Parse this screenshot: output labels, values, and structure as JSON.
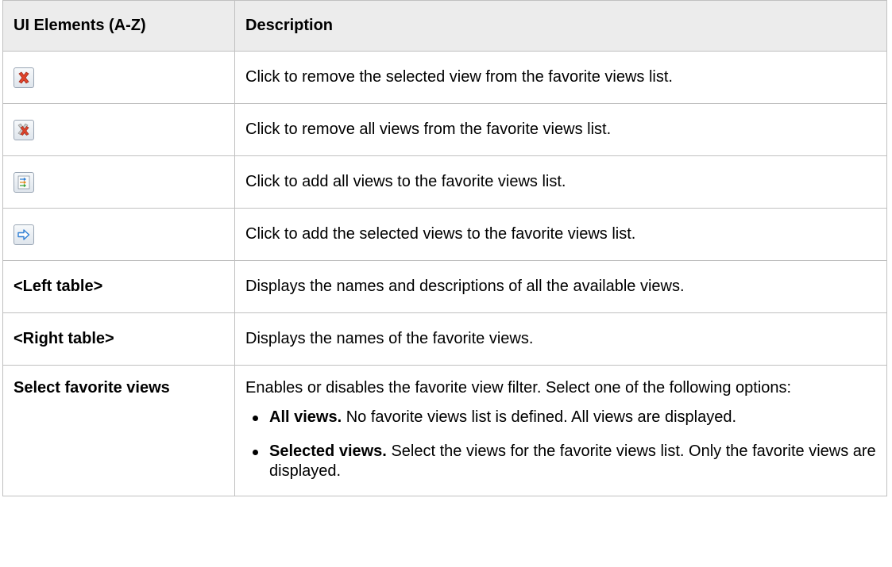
{
  "table": {
    "headers": {
      "col1": "UI Elements (A-Z)",
      "col2": "Description"
    },
    "rows": [
      {
        "icon": "remove-selected-icon",
        "description": "Click to remove the selected view from the favorite views list."
      },
      {
        "icon": "remove-all-icon",
        "description": "Click to remove all views from the favorite views list."
      },
      {
        "icon": "add-all-icon",
        "description": "Click to add all views to the favorite views list."
      },
      {
        "icon": "add-selected-icon",
        "description": "Click to add the selected views to the favorite views list."
      },
      {
        "element": "<Left table>",
        "description": "Displays the names and descriptions of all the available views."
      },
      {
        "element": "<Right table>",
        "description": "Displays the names of the favorite views."
      },
      {
        "element": "Select favorite views",
        "description": "Enables or disables the favorite view filter. Select one of the following options:",
        "options": [
          {
            "label": "All views.",
            "text": "No favorite views list is defined. All views are displayed."
          },
          {
            "label": "Selected views.",
            "text": "Select the views for the favorite views list. Only the favorite views are displayed."
          }
        ]
      }
    ]
  },
  "colors": {
    "header_bg": "#ececec",
    "border": "#c0c0c0",
    "remove_red": "#e0442c",
    "add_blue": "#2f7fd4"
  }
}
